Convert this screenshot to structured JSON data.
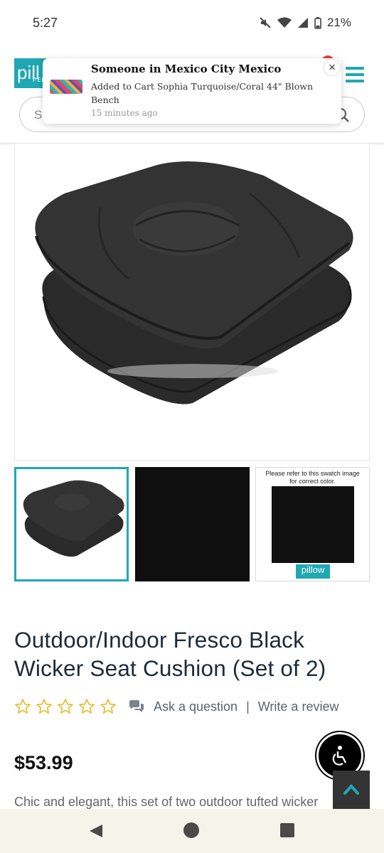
{
  "status_bar": {
    "time": "5:27",
    "battery": "21%"
  },
  "header": {
    "logo_text": "pill",
    "logo_subtext": "PER",
    "search_placeholder": "Se"
  },
  "toast": {
    "title": "Someone in Mexico City Mexico",
    "body": "Added to Cart Sophia Turquoise/Coral 44\" Blown Bench",
    "time": "15 minutes ago",
    "close_glyph": "×"
  },
  "gallery": {
    "swatch_note": "Please refer to this swatch image for correct color.",
    "swatch_logo": "pillow",
    "selected_index": 0
  },
  "product": {
    "title": "Outdoor/Indoor Fresco Black Wicker Seat Cushion (Set of 2)",
    "rating": 0,
    "rating_max": 5,
    "ask_label": "Ask a question",
    "separator": "|",
    "review_label": "Write a review",
    "price": "$53.99",
    "description": "Chic and elegant, this set of two outdoor tufted wicker"
  },
  "colors": {
    "brand_teal": "#1fa8b3",
    "star_yellow": "#e8b923",
    "text_dark": "#1e2a3a"
  },
  "icons": {
    "search": "search-icon",
    "menu": "hamburger-menu-icon",
    "chat": "chat-bubbles-icon",
    "accessibility": "accessibility-icon",
    "scroll_top": "chevron-up-icon"
  }
}
